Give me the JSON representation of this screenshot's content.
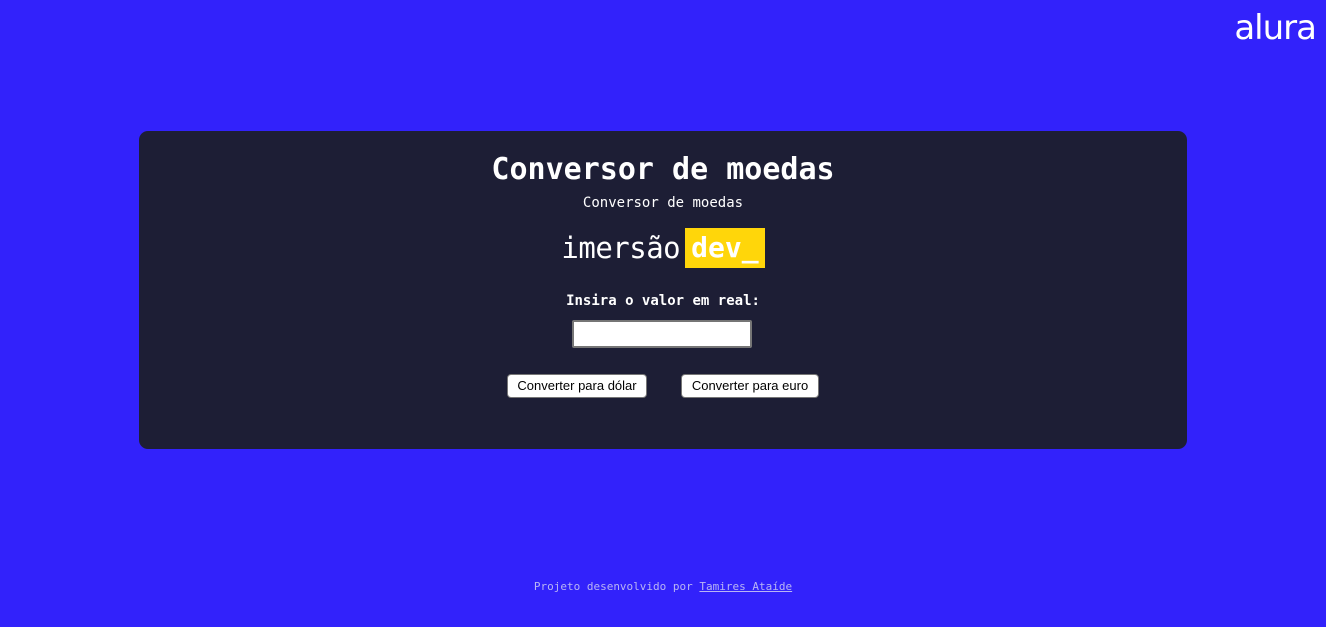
{
  "logo": {
    "text": "alura"
  },
  "card": {
    "title": "Conversor de moedas",
    "subtitle": "Conversor de moedas",
    "brand": {
      "part1": "imersão",
      "part2": "dev_"
    },
    "input_label": "Insira o valor em real:",
    "input": {
      "value": "",
      "placeholder": ""
    },
    "buttons": {
      "to_dollar": "Converter para dólar",
      "to_euro": "Converter para euro"
    }
  },
  "footer": {
    "text": "Projeto desenvolvido por",
    "author_link": "Tamires Ataíde"
  },
  "colors": {
    "background": "#3222fb",
    "card": "#1d1e35",
    "accent": "#ffd60a",
    "text": "#ffffff",
    "footer_text": "#b9b5f4"
  }
}
